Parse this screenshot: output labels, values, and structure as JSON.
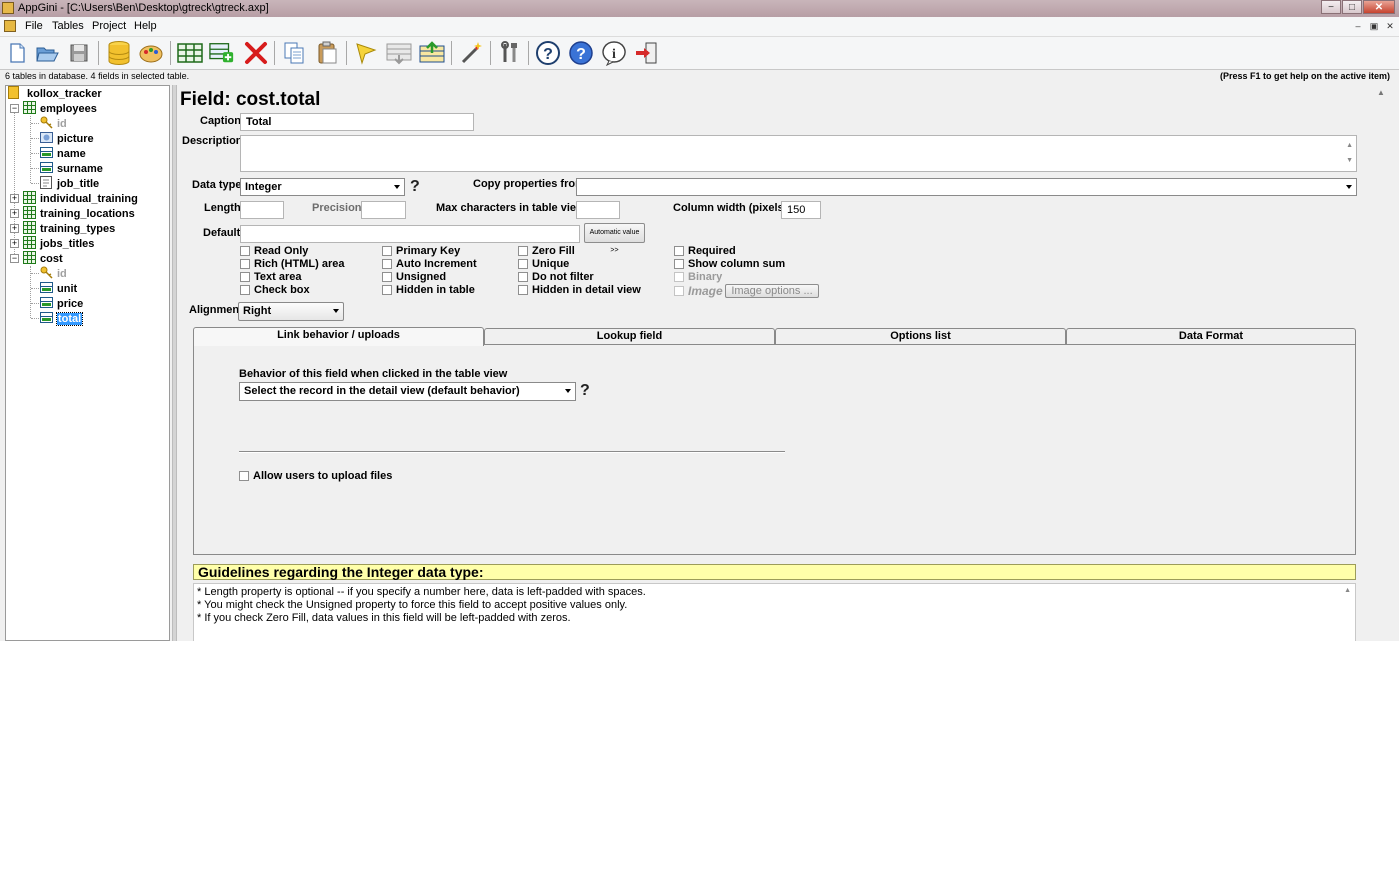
{
  "window": {
    "title": "AppGini - [C:\\Users\\Ben\\Desktop\\gtreck\\gtreck.axp]",
    "minimize": "−",
    "maximize": "□",
    "close": "✕"
  },
  "menu": {
    "items": [
      "File",
      "Tables",
      "Project",
      "Help"
    ],
    "mdi": [
      "–",
      "▣",
      "✕"
    ]
  },
  "toolbar": {
    "buttons": [
      "new-project-icon",
      "open-project-icon",
      "save-project-icon",
      "database-icon",
      "themes-palette-icon",
      "add-table-icon",
      "add-field-icon",
      "delete-icon",
      "copy-icon",
      "paste-icon",
      "highlight-icon",
      "move-down-icon",
      "move-up-icon",
      "magic-wand-icon",
      "tools-icon",
      "help-icon",
      "help-blue-icon",
      "info-icon",
      "exit-icon"
    ]
  },
  "status": {
    "left": "6 tables in database. 4 fields in selected table.",
    "right": "(Press F1 to get help on the active item)"
  },
  "tree": {
    "root": "kollox_tracker",
    "employees": "employees",
    "employees_fields": [
      "id",
      "picture",
      "name",
      "surname",
      "job_title"
    ],
    "individual_training": "individual_training",
    "training_locations": "training_locations",
    "training_types": "training_types",
    "jobs_titles": "jobs_titles",
    "cost": "cost",
    "cost_fields": [
      "id",
      "unit",
      "price",
      "total"
    ]
  },
  "field": {
    "heading": "Field: cost.total",
    "caption_label": "Caption",
    "caption_value": "Total",
    "description_label": "Description",
    "description_value": "",
    "datatype_label": "Data type",
    "datatype_value": "Integer",
    "help_mark": "?",
    "copy_label": "Copy properties from",
    "copy_value": "",
    "length_label": "Length",
    "length_value": "",
    "precision_label": "Precision",
    "precision_value": "",
    "maxchars_label": "Max characters in table view",
    "maxchars_value": "",
    "colwidth_label": "Column width (pixels)",
    "colwidth_value": "150",
    "default_label": "Default",
    "default_value": "",
    "auto_value_button": "Automatic value >>",
    "alignment_label": "Alignment",
    "alignment_value": "Right",
    "image_options_button": "Image options ..."
  },
  "checkboxes": {
    "col1": [
      "Read Only",
      "Rich (HTML) area",
      "Text area",
      "Check box"
    ],
    "col2": [
      "Primary Key",
      "Auto Increment",
      "Unsigned",
      "Hidden in table"
    ],
    "col3": [
      "Zero Fill",
      "Unique",
      "Do not filter",
      "Hidden in detail view"
    ],
    "col4": [
      "Required",
      "Show column sum",
      "Binary",
      "Image"
    ],
    "checked": "none"
  },
  "tabs": [
    "Link behavior / uploads",
    "Lookup field",
    "Options list",
    "Data Format"
  ],
  "link_tab": {
    "behavior_label": "Behavior of this field when clicked in the table view",
    "behavior_value": "Select the record in the detail view (default behavior)",
    "upload_label": "Allow users to upload files"
  },
  "guidelines": {
    "title": "Guidelines regarding the Integer data type:",
    "lines": [
      "* Length property is optional -- if you specify a number here, data is left-padded with spaces.",
      "* You might check the Unsigned property to force this field to accept positive values only.",
      "* If you check Zero Fill, data values in this field will be left-padded with zeros."
    ]
  }
}
